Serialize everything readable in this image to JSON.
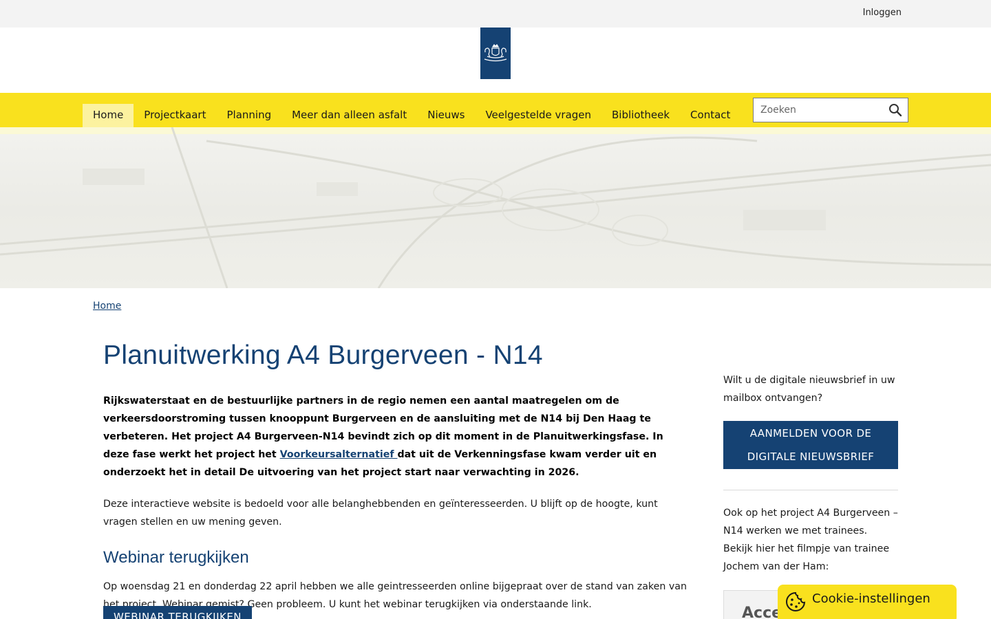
{
  "topbar": {
    "login_label": "Inloggen"
  },
  "navigation": {
    "items": [
      {
        "label": "Home",
        "active": true
      },
      {
        "label": "Projectkaart",
        "active": false
      },
      {
        "label": "Planning",
        "active": false
      },
      {
        "label": "Meer dan alleen asfalt",
        "active": false
      },
      {
        "label": "Nieuws",
        "active": false
      },
      {
        "label": "Veelgestelde vragen",
        "active": false
      },
      {
        "label": "Bibliotheek",
        "active": false
      },
      {
        "label": "Contact",
        "active": false
      }
    ],
    "search_placeholder": "Zoeken"
  },
  "breadcrumb": {
    "home_label": "Home"
  },
  "main": {
    "title": "Planuitwerking A4 Burgerveen - N14",
    "lead_part1": "Rijkswaterstaat en de bestuurlijke partners in de regio nemen een aantal maatregelen om de verkeersdoorstroming tussen knooppunt Burgerveen en de aansluiting met de N14 bij Den Haag te verbeteren. Het project A4 Burgerveen-N14 bevindt zich op dit moment in de Planuitwerkingsfase. In deze fase werkt het project het ",
    "lead_link": "Voorkeursalternatief ",
    "lead_part2": "dat uit de Verkenningsfase kwam verder uit en onderzoekt het in detail De uitvoering van het project start naar verwachting in 2026.",
    "intro": "Deze interactieve website is bedoeld voor alle belanghebbenden en geïnteresseerden. U blijft op de hoogte, kunt vragen stellen en uw mening geven.",
    "webinar_heading": "Webinar terugkijken",
    "webinar_text": "Op woensdag 21 en donderdag 22 april hebben we alle geintresseerden online bijgepraat over de stand van zaken van het project. Webinar gemist? Geen probleem. U kunt het webinar terugkijken via onderstaande link.",
    "webinar_button": "WEBINAR TERUGKIJKEN"
  },
  "sidebar": {
    "newsletter_text": "Wilt u de digitale nieuwsbrief in uw mailbox ontvangen?",
    "newsletter_button_line1": "AANMELDEN VOOR DE",
    "newsletter_button_line2": "DIGITALE NIEUWSBRIEF",
    "trainee_text": "Ook op het project A4 Burgerveen – N14 werken we met trainees. Bekijk hier het filmpje van trainee Jochem van der Ham:",
    "video_partial_text": "Acce"
  },
  "cookie_banner": {
    "label": "Cookie-instellingen"
  },
  "colors": {
    "brand_blue": "#154273",
    "brand_yellow": "#f9e11e",
    "active_nav": "#fcf29f",
    "topbar": "#f3f3f3"
  },
  "icons": {
    "logo": "crest-icon",
    "search": "search-icon",
    "cookie": "cookie-icon"
  }
}
